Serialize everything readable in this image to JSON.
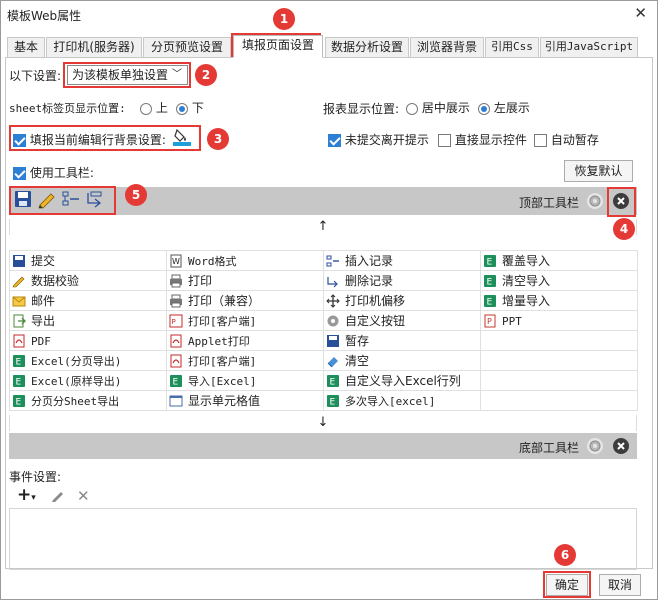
{
  "window": {
    "title": "模板Web属性",
    "close_glyph": "✕"
  },
  "tabs": [
    {
      "label": "基本",
      "mono": false
    },
    {
      "label": "打印机(服务器)",
      "mono": false
    },
    {
      "label": "分页预览设置",
      "mono": false
    },
    {
      "label": "填报页面设置",
      "mono": false,
      "active": true
    },
    {
      "label": "数据分析设置",
      "mono": false
    },
    {
      "label": "浏览器背景",
      "mono": false
    },
    {
      "label": "引用Css",
      "mono": true
    },
    {
      "label": "引用JavaScript",
      "mono": true
    }
  ],
  "settings": {
    "scope_label": "以下设置:",
    "scope_value": "为该模板单独设置",
    "sheet_label": "sheet标签页显示位置:",
    "sheet_options": [
      "上",
      "下"
    ],
    "sheet_selected": "下",
    "report_label": "报表显示位置:",
    "report_options": [
      "居中展示",
      "左展示"
    ],
    "report_selected": "左展示",
    "fill_bg_label": "填报当前编辑行背景设置:",
    "fill_bg_checked": true,
    "unsubmitted_label": "未提交离开提示",
    "unsubmitted_checked": true,
    "direct_control_label": "直接显示控件",
    "direct_control_checked": false,
    "autosave_label": "自动暂存",
    "autosave_checked": false,
    "use_toolbar_label": "使用工具栏:",
    "use_toolbar_checked": true,
    "restore_default_label": "恢复默认"
  },
  "toolbar": {
    "top_label": "顶部工具栏",
    "bottom_label": "底部工具栏",
    "up_arrow": "↑",
    "down_arrow": "↓"
  },
  "grid_rows": [
    [
      {
        "icon": "save",
        "label": "提交"
      },
      {
        "icon": "word",
        "label": "Word格式",
        "mono": true
      },
      {
        "icon": "insert",
        "label": "插入记录"
      },
      {
        "icon": "excel",
        "label": "覆盖导入"
      }
    ],
    [
      {
        "icon": "pencil",
        "label": "数据校验"
      },
      {
        "icon": "print",
        "label": "打印"
      },
      {
        "icon": "delete",
        "label": "删除记录"
      },
      {
        "icon": "excel",
        "label": "清空导入"
      }
    ],
    [
      {
        "icon": "mail",
        "label": "邮件"
      },
      {
        "icon": "print",
        "label": "打印（兼容）"
      },
      {
        "icon": "move",
        "label": "打印机偏移"
      },
      {
        "icon": "excel",
        "label": "增量导入"
      }
    ],
    [
      {
        "icon": "export",
        "label": "导出"
      },
      {
        "icon": "pdfprint",
        "label": "打印[客户端]",
        "mono": true
      },
      {
        "icon": "gear",
        "label": "自定义按钮"
      },
      {
        "icon": "ppt",
        "label": "PPT",
        "mono": true
      }
    ],
    [
      {
        "icon": "pdf",
        "label": "PDF",
        "mono": true
      },
      {
        "icon": "pdf",
        "label": "Applet打印",
        "mono": true
      },
      {
        "icon": "save",
        "label": "暂存"
      },
      {
        "icon": "",
        "label": ""
      }
    ],
    [
      {
        "icon": "excel",
        "label": "Excel(分页导出)",
        "mono": true
      },
      {
        "icon": "pdf",
        "label": "打印[客户端]",
        "mono": true
      },
      {
        "icon": "eraser",
        "label": "清空"
      },
      {
        "icon": "",
        "label": ""
      }
    ],
    [
      {
        "icon": "excel",
        "label": "Excel(原样导出)",
        "mono": true
      },
      {
        "icon": "excel",
        "label": "导入[Excel]",
        "mono": true
      },
      {
        "icon": "excel",
        "label": "自定义导入Excel行列"
      },
      {
        "icon": "",
        "label": ""
      }
    ],
    [
      {
        "icon": "excel",
        "label": "分页分Sheet导出",
        "mono": true
      },
      {
        "icon": "cell",
        "label": "显示单元格值"
      },
      {
        "icon": "excel",
        "label": "多次导入[excel]",
        "mono": true
      },
      {
        "icon": "",
        "label": ""
      }
    ]
  ],
  "events": {
    "label": "事件设置:"
  },
  "footer": {
    "ok_label": "确定",
    "cancel_label": "取消"
  },
  "badges": [
    "1",
    "2",
    "3",
    "4",
    "5",
    "6"
  ],
  "colors": {
    "annotation_red": "#e53935",
    "accent_blue": "#2d7fd6",
    "toolbar_gray": "#c7c7c7"
  }
}
